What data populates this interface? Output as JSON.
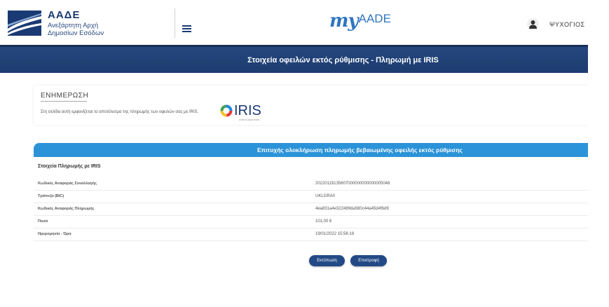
{
  "header": {
    "logo_title": "ΑΑΔΕ",
    "logo_sub_line1": "Ανεξάρτητη Αρχή",
    "logo_sub_line2": "Δημοσίων Εσόδων",
    "brand_my": "my",
    "brand_aade": "AADE",
    "username": "ΨΥΧΟΓΙΟΣ",
    "accent_color": "#2f75c0"
  },
  "page_title": "Στοιχεία οφειλών εκτός ρύθμισης - Πληρωμή με IRIS",
  "info": {
    "title": "ΕΝΗΜΕΡΩΣΗ",
    "text": "Στη σελίδα αυτή εμφανίζεται το αποτέλεσμα της πληρωμής των οφειλών σας με IRIS.",
    "iris_word": "IRIS",
    "iris_tag": "online payments"
  },
  "result": {
    "header": "Επιτυχής ολοκλήρωση πληρωμής βεβαιωμένης οφειλής εκτός ρύθμισης",
    "section_title": "Στοιχεία Πληρωμής με IRIS",
    "rows": [
      {
        "label": "Κωδικός Αναφοράς Συναλλαγής",
        "value": "20220119135607000000000000005048"
      },
      {
        "label": "Τράπεζα (BIC)",
        "value": "UKLGRA0"
      },
      {
        "label": "Κωδικός Αναφοράς Πληρωμής",
        "value": "4ea831a4e322489da560c44a45d4fbd9"
      },
      {
        "label": "Ποσό",
        "value": "101,00 €"
      },
      {
        "label": "Ημερομηνία - Ώρα",
        "value": "19/01/2022 15:56:18"
      }
    ],
    "header_color": "#2b93d8"
  },
  "buttons": {
    "print": "Εκτύπωση",
    "back": "Επιστροφή"
  },
  "icons": {
    "flag": "aade-flag-logo",
    "menu": "hamburger-menu-icon",
    "user": "user-avatar-icon",
    "iris": "iris-logo"
  },
  "colors": {
    "title_band": "#1d3c6e",
    "button": "#234a86"
  }
}
